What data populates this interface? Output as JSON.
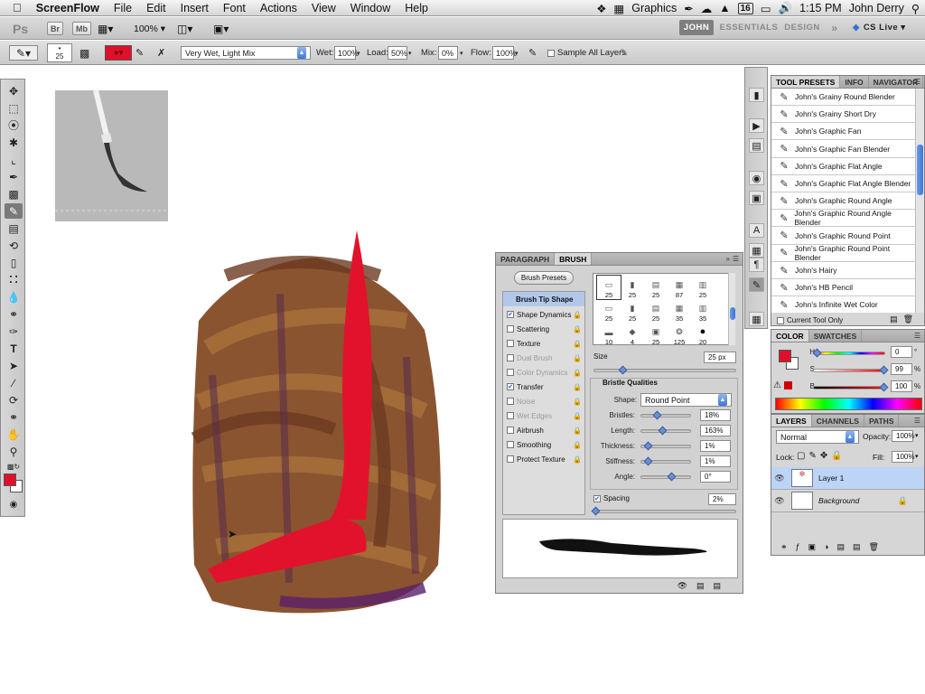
{
  "menubar": {
    "app": "ScreenFlow",
    "items": [
      "File",
      "Edit",
      "Insert",
      "Font",
      "Actions",
      "View",
      "Window",
      "Help"
    ],
    "right_label": "Graphics",
    "badge": "16",
    "time": "1:15 PM",
    "user": "John Derry"
  },
  "appbar": {
    "ps": "Ps",
    "br": "Br",
    "mb": "Mb",
    "zoom": "100%",
    "workspaces": [
      "JOHN",
      "ESSENTIALS",
      "DESIGN"
    ],
    "more": "»",
    "cslive": "CS Live"
  },
  "options": {
    "brush_size": "25",
    "mix_preset": "Very Wet, Light Mix",
    "wet_label": "Wet:",
    "wet": "100%",
    "load_label": "Load:",
    "load": "50%",
    "mix_label": "Mix:",
    "mix": "0%",
    "flow_label": "Flow:",
    "flow": "100%",
    "sample_all": "Sample All Layers",
    "color": "#e0102a"
  },
  "tool_presets": {
    "tabs": [
      "TOOL PRESETS",
      "INFO",
      "NAVIGATOR"
    ],
    "items": [
      "John's Grainy Round Blender",
      "John's Grainy Short Dry",
      "John's Graphic Fan",
      "John's Graphic Fan Blender",
      "John's Graphic Flat Angle",
      "John's Graphic Flat Angle Blender",
      "John's Graphic Round Angle",
      "John's Graphic Round Angle Blender",
      "John's Graphic Round Point",
      "John's Graphic Round Point Blender",
      "John's Hairy",
      "John's HB Pencil",
      "John's Infinite Wet Color"
    ],
    "current_tool_only": "Current Tool Only"
  },
  "color_panel": {
    "tabs": [
      "COLOR",
      "SWATCHES"
    ],
    "h_label": "H",
    "h": "0",
    "h_unit": "°",
    "s_label": "S",
    "s": "99",
    "s_unit": "%",
    "b_label": "B",
    "b": "100",
    "b_unit": "%",
    "fg": "#e0102a"
  },
  "layers": {
    "tabs": [
      "LAYERS",
      "CHANNELS",
      "PATHS"
    ],
    "blend": "Normal",
    "opacity_label": "Opacity:",
    "opacity": "100%",
    "lock_label": "Lock:",
    "fill_label": "Fill:",
    "fill": "100%",
    "rows": [
      {
        "name": "Layer 1"
      },
      {
        "name": "Background"
      }
    ]
  },
  "brush_panel": {
    "tabs": [
      "PARAGRAPH",
      "BRUSH"
    ],
    "presets_btn": "Brush Presets",
    "tip_shape": "Brush Tip Shape",
    "options": [
      {
        "label": "Shape Dynamics",
        "checked": true,
        "disabled": false
      },
      {
        "label": "Scattering",
        "checked": false,
        "disabled": false
      },
      {
        "label": "Texture",
        "checked": false,
        "disabled": false
      },
      {
        "label": "Dual Brush",
        "checked": false,
        "disabled": true
      },
      {
        "label": "Color Dynamics",
        "checked": false,
        "disabled": true
      },
      {
        "label": "Transfer",
        "checked": true,
        "disabled": false
      },
      {
        "label": "Noise",
        "checked": false,
        "disabled": true
      },
      {
        "label": "Wet Edges",
        "checked": false,
        "disabled": true
      },
      {
        "label": "Airbrush",
        "checked": false,
        "disabled": false
      },
      {
        "label": "Smoothing",
        "checked": false,
        "disabled": false
      },
      {
        "label": "Protect Texture",
        "checked": false,
        "disabled": false
      }
    ],
    "tips": [
      "25",
      "25",
      "25",
      "87",
      "25",
      "25",
      "25",
      "25",
      "35",
      "35",
      "10",
      "4",
      "25",
      "125",
      "20"
    ],
    "size_label": "Size",
    "size": "25 px",
    "bristle_title": "Bristle Qualities",
    "shape_label": "Shape:",
    "shape": "Round Point",
    "params": [
      {
        "label": "Bristles:",
        "value": "18%"
      },
      {
        "label": "Length:",
        "value": "163%"
      },
      {
        "label": "Thickness:",
        "value": "1%"
      },
      {
        "label": "Stiffness:",
        "value": "1%"
      },
      {
        "label": "Angle:",
        "value": "0°"
      }
    ],
    "spacing_label": "Spacing",
    "spacing": "2%"
  }
}
